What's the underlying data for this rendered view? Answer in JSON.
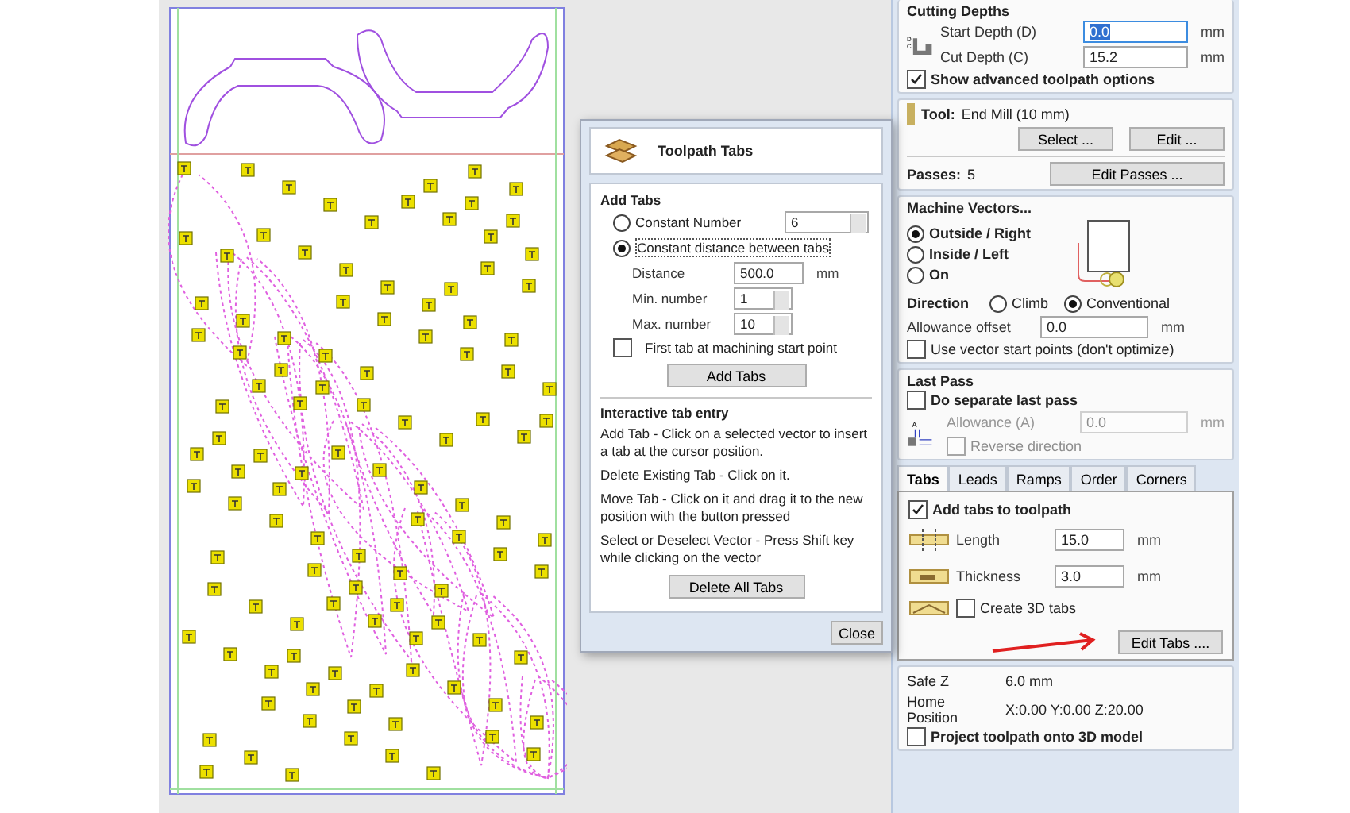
{
  "dialog": {
    "title": "Toolpath Tabs",
    "add_tabs_heading": "Add Tabs",
    "modes": [
      {
        "label": "Constant Number",
        "selected": false,
        "value": "6"
      },
      {
        "label": "Constant distance between tabs",
        "selected": true
      }
    ],
    "fields": [
      {
        "label": "Distance",
        "value": "500.0",
        "unit": "mm",
        "kind": "text"
      },
      {
        "label": "Min. number",
        "value": "1",
        "kind": "spin"
      },
      {
        "label": "Max. number",
        "value": "10",
        "kind": "spin"
      }
    ],
    "first_tab": {
      "label": "First tab at machining start point",
      "checked": false
    },
    "add_button": "Add Tabs",
    "interactive_heading": "Interactive tab entry",
    "instructions": [
      "Add Tab - Click on a selected vector to insert a tab at the cursor position.",
      "Delete Existing Tab - Click on it.",
      "Move Tab - Click on it and drag it to the new position with the button pressed",
      "Select or Deselect Vector - Press Shift key while clicking on the vector"
    ],
    "delete_button": "Delete All Tabs",
    "close_button": "Close"
  },
  "cutting_depths": {
    "heading": "Cutting Depths",
    "diagram_labels": [
      "D",
      "C"
    ],
    "fields": [
      {
        "label": "Start Depth (D)",
        "value": "0.0",
        "unit": "mm",
        "selected": true
      },
      {
        "label": "Cut Depth (C)",
        "value": "15.2",
        "unit": "mm",
        "selected": false
      }
    ],
    "advanced": {
      "label": "Show advanced toolpath options",
      "checked": true
    }
  },
  "tool": {
    "label": "Tool:",
    "name": "End Mill (10 mm)",
    "buttons": [
      "Select ...",
      "Edit ..."
    ],
    "passes_label": "Passes:",
    "passes": "5",
    "passes_button": "Edit Passes ..."
  },
  "machine_vectors": {
    "heading": "Machine Vectors...",
    "sides": [
      {
        "label": "Outside / Right",
        "selected": true
      },
      {
        "label": "Inside / Left",
        "selected": false
      },
      {
        "label": "On",
        "selected": false
      }
    ],
    "direction_label": "Direction",
    "directions": [
      {
        "label": "Climb",
        "selected": false
      },
      {
        "label": "Conventional",
        "selected": true
      }
    ],
    "allowance_label": "Allowance offset",
    "allowance": "0.0",
    "unit": "mm",
    "start_points": {
      "label": "Use vector start points (don't optimize)",
      "checked": false
    }
  },
  "last_pass": {
    "heading": "Last Pass",
    "separate": {
      "label": "Do separate last pass",
      "checked": false
    },
    "diagram_label": "A",
    "allowance_label": "Allowance (A)",
    "allowance": "0.0",
    "unit": "mm",
    "reverse": {
      "label": "Reverse direction",
      "checked": false
    }
  },
  "tabs": [
    {
      "label": "Tabs",
      "selected": true
    },
    {
      "label": "Leads",
      "selected": false
    },
    {
      "label": "Ramps",
      "selected": false
    },
    {
      "label": "Order",
      "selected": false
    },
    {
      "label": "Corners",
      "selected": false
    }
  ],
  "tabs_panel": {
    "add": {
      "label": "Add tabs to toolpath",
      "checked": true
    },
    "fields": [
      {
        "label": "Length",
        "value": "15.0",
        "unit": "mm"
      },
      {
        "label": "Thickness",
        "value": "3.0",
        "unit": "mm"
      }
    ],
    "create_3d": {
      "label": "Create 3D tabs",
      "checked": false
    },
    "edit_button": "Edit Tabs ...."
  },
  "summary": {
    "rows": [
      {
        "label": "Safe Z",
        "value": "6.0 mm"
      },
      {
        "label": "Home Position",
        "value": "X:0.00 Y:0.00 Z:20.00"
      }
    ],
    "project": {
      "label": "Project toolpath onto 3D model",
      "checked": false
    }
  }
}
